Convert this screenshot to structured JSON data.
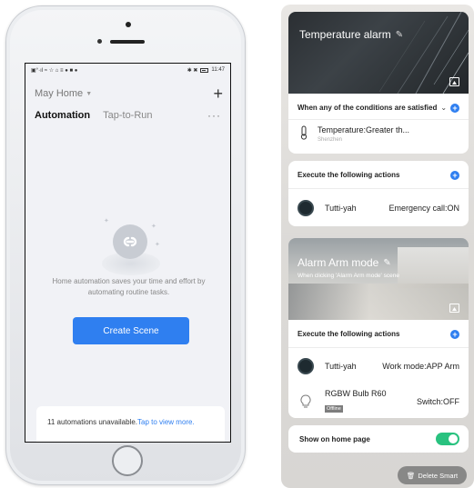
{
  "phone": {
    "status_left": "▣°·ıl ≈ ☆ ⌂ ≡ ● ■ ●",
    "status_icons_right": "✱ ✖",
    "status_time": "11:47",
    "home_selector": "May Home",
    "tabs": [
      {
        "label": "Automation",
        "active": true
      },
      {
        "label": "Tap-to-Run",
        "active": false
      }
    ],
    "more": "···",
    "empty_text": "Home automation saves your time and effort by automating routine tasks.",
    "create_button": "Create Scene",
    "notice_text": "11 automations unavailable.",
    "notice_link": "Tap to view more.",
    "accent_color": "#2f7ff0"
  },
  "temperature_scene": {
    "title": "Temperature alarm",
    "condition_header": "When any of the conditions are satisfied",
    "condition_label": "Temperature:Greater th...",
    "condition_location": "Shenzhen",
    "actions_header": "Execute the following actions",
    "actions": [
      {
        "device": "Tutti-yah",
        "state": "Emergency call:ON"
      }
    ]
  },
  "alarm_scene": {
    "title": "Alarm Arm mode",
    "subtitle": "When clicking 'Alarm Arm mode' scene",
    "actions_header": "Execute the following actions",
    "actions": [
      {
        "device": "Tutti-yah",
        "state": "Work mode:APP Arm",
        "badge": ""
      },
      {
        "device": "RGBW Bulb R60",
        "state": "Switch:OFF",
        "badge": "Offline"
      }
    ],
    "show_on_home_label": "Show on home page",
    "show_on_home": true,
    "delete_label": "Delete Smart",
    "toggle_color": "#29c27f"
  }
}
